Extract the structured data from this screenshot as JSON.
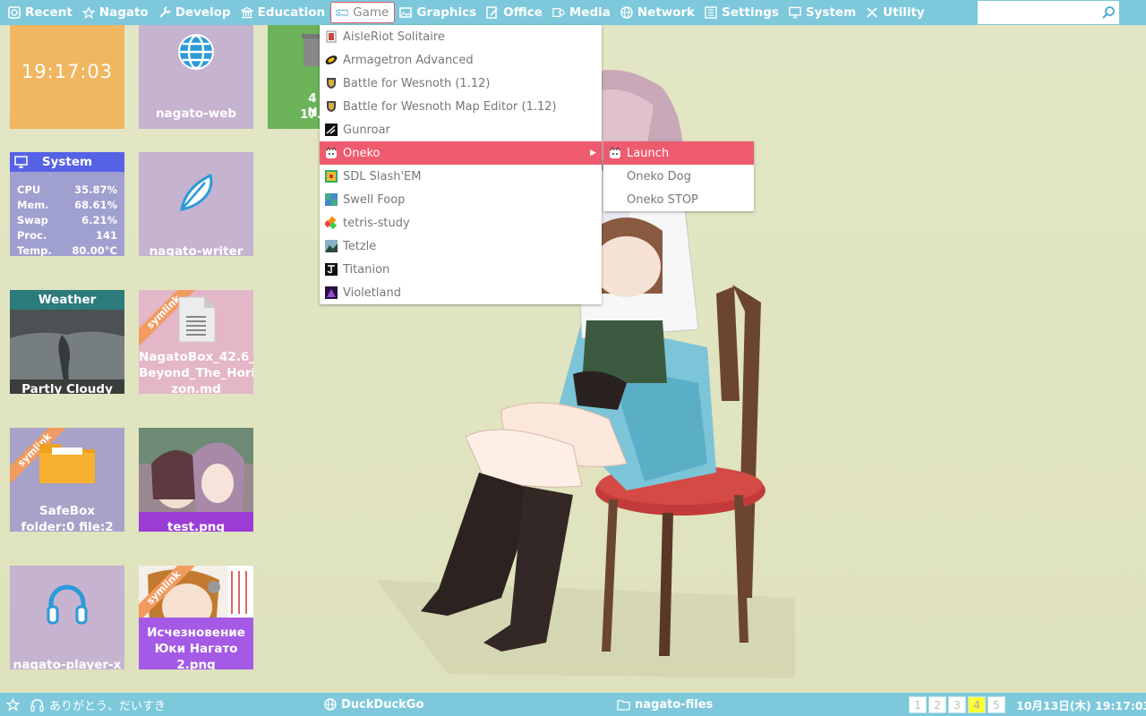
{
  "topbar": {
    "items": [
      {
        "label": "Recent",
        "icon": "recent-icon"
      },
      {
        "label": "Nagato",
        "icon": "star-icon"
      },
      {
        "label": "Develop",
        "icon": "wrench-icon"
      },
      {
        "label": "Education",
        "icon": "school-icon"
      },
      {
        "label": "Game",
        "icon": "gamepad-icon"
      },
      {
        "label": "Graphics",
        "icon": "picture-icon"
      },
      {
        "label": "Office",
        "icon": "document-edit-icon"
      },
      {
        "label": "Media",
        "icon": "media-icon"
      },
      {
        "label": "Network",
        "icon": "globe-icon"
      },
      {
        "label": "Settings",
        "icon": "settings-icon"
      },
      {
        "label": "System",
        "icon": "monitor-icon"
      },
      {
        "label": "Utility",
        "icon": "tools-icon"
      }
    ],
    "search_value": ""
  },
  "tiles": {
    "clock": "19:17:03",
    "web": "nagato-web",
    "partial": [
      "4 N",
      "17."
    ],
    "system": {
      "title": "System",
      "rows": [
        {
          "k": "CPU",
          "v": "35.87%"
        },
        {
          "k": "Mem.",
          "v": "68.61%"
        },
        {
          "k": "Swap",
          "v": "6.21%"
        },
        {
          "k": "Proc.",
          "v": "141"
        },
        {
          "k": "Temp.",
          "v": "80.00°C"
        }
      ]
    },
    "writer": "nagato-writer",
    "weather": {
      "title": "Weather",
      "status": "Partly Cloudy"
    },
    "mdfile": {
      "ribbon": "symlink",
      "name": [
        "NagatoBox_42.6_",
        "Beyond_The_Hori",
        "zon.md"
      ]
    },
    "safebox": {
      "ribbon": "symlink",
      "name": [
        "SafeBox",
        "folder:0 file:2"
      ]
    },
    "testpng": "test.png",
    "player": "nagato-player-x",
    "yuki": {
      "ribbon": "symlink",
      "name": [
        "Исчезновение",
        "Юки Нагато",
        "2.png"
      ]
    }
  },
  "game_menu": [
    "AisleRiot Solitaire",
    "Armagetron Advanced",
    "Battle for Wesnoth (1.12)",
    "Battle for Wesnoth Map Editor (1.12)",
    "Gunroar",
    "Oneko",
    "SDL Slash'EM",
    "Swell Foop",
    "tetris-study",
    "Tetzle",
    "Titanion",
    "Violetland"
  ],
  "oneko_submenu": [
    "Launch",
    "Oneko Dog",
    "Oneko STOP"
  ],
  "bottombar": {
    "music": "ありがとう、だいすき",
    "browser": "DuckDuckGo",
    "files": "nagato-files",
    "workspaces": [
      "1",
      "2",
      "3",
      "4",
      "5"
    ],
    "current_workspace": "4",
    "datetime": "10月13日(木) 19:17:03"
  },
  "colors": {
    "panel": "#7ec8dc",
    "highlight": "#ef5b6e",
    "clock_tile": "#f0b660",
    "purple_tile": "#c6b3d0",
    "green_tile": "#6db35a",
    "system_header": "#5562e6",
    "weather_header": "#2d7b7b"
  }
}
